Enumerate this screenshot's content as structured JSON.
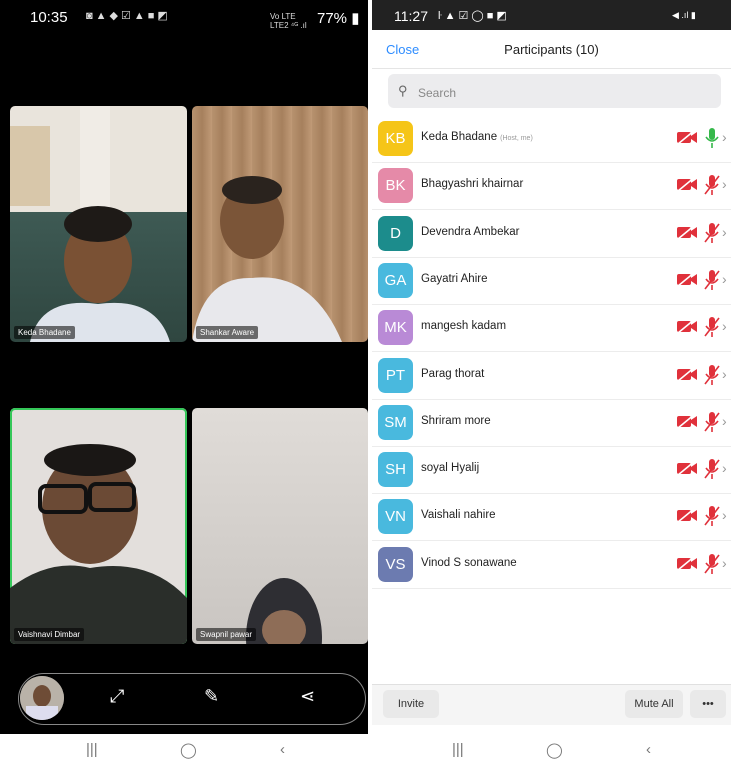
{
  "left_status": {
    "time": "10:35",
    "battery": "77%",
    "network": "Vo LTE\nLTE2"
  },
  "tiles": [
    {
      "name": "Keda Bhadane"
    },
    {
      "name": "Shankar Aware"
    },
    {
      "name": "Vaishnavi Dimbar"
    },
    {
      "name": "Swapnil pawar"
    }
  ],
  "right_status": {
    "time": "11:27"
  },
  "header": {
    "close": "Close",
    "title": "Participants (10)"
  },
  "search": {
    "placeholder": "Search"
  },
  "participants": [
    {
      "initials": "KB",
      "name": "Keda Bhadane",
      "tag": "(Host, me)",
      "color": "#F5C518",
      "mic_on": true
    },
    {
      "initials": "BK",
      "name": "Bhagyashri khairnar",
      "tag": "",
      "color": "#E58AA8",
      "mic_on": false
    },
    {
      "initials": "D",
      "name": "Devendra Ambekar",
      "tag": "",
      "color": "#1C8C8C",
      "mic_on": false
    },
    {
      "initials": "GA",
      "name": "Gayatri Ahire",
      "tag": "",
      "color": "#49B9DE",
      "mic_on": false
    },
    {
      "initials": "MK",
      "name": "mangesh kadam",
      "tag": "",
      "color": "#B98AD6",
      "mic_on": false
    },
    {
      "initials": "PT",
      "name": "Parag thorat",
      "tag": "",
      "color": "#49B9DE",
      "mic_on": false
    },
    {
      "initials": "SM",
      "name": "Shriram more",
      "tag": "",
      "color": "#49B9DE",
      "mic_on": false
    },
    {
      "initials": "SH",
      "name": "soyal Hyalij",
      "tag": "",
      "color": "#49B9DE",
      "mic_on": false
    },
    {
      "initials": "VN",
      "name": "Vaishali nahire",
      "tag": "",
      "color": "#49B9DE",
      "mic_on": false
    },
    {
      "initials": "VS",
      "name": "Vinod S sonawane",
      "tag": "",
      "color": "#6C7BB0",
      "mic_on": false
    }
  ],
  "footer": {
    "invite": "Invite",
    "mute_all": "Mute All",
    "more": "•••"
  },
  "icons": {
    "camera_off": "camera-off-icon",
    "mic_off": "mic-off-icon",
    "mic_on": "mic-on-icon",
    "chevron": "chevron-right-icon"
  }
}
